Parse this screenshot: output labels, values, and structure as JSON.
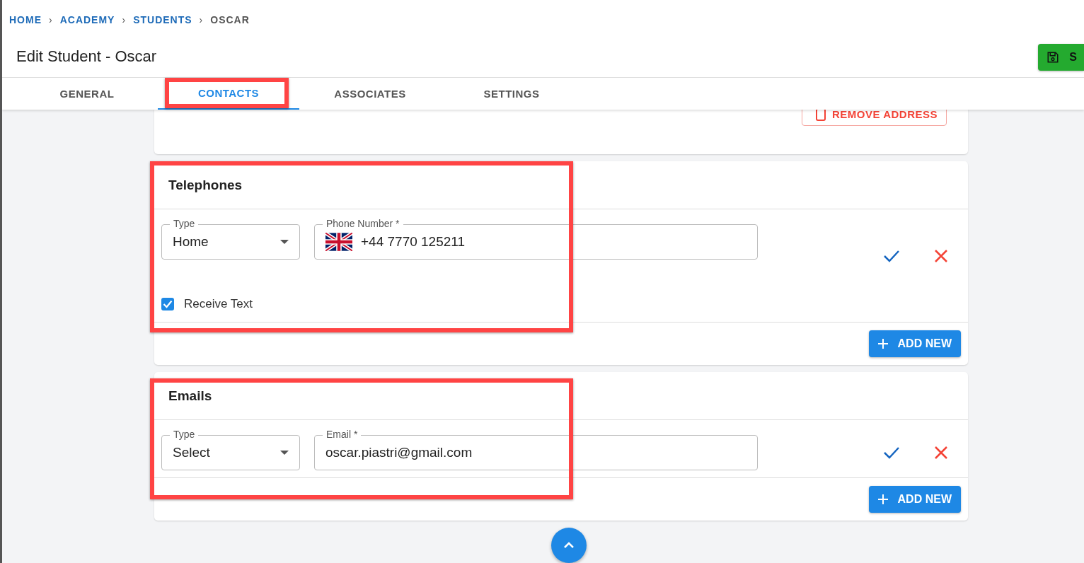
{
  "breadcrumb": [
    {
      "label": "HOME",
      "current": false
    },
    {
      "label": "ACADEMY",
      "current": false
    },
    {
      "label": "STUDENTS",
      "current": false
    },
    {
      "label": "OSCAR",
      "current": true
    }
  ],
  "breadcrumb_separator": "›",
  "title": "Edit Student - Oscar",
  "save_button": {
    "label": "S"
  },
  "tabs": [
    {
      "label": "GENERAL",
      "selected": false,
      "highlighted": false
    },
    {
      "label": "CONTACTS",
      "selected": true,
      "highlighted": true
    },
    {
      "label": "ASSOCIATES",
      "selected": false,
      "highlighted": false
    },
    {
      "label": "SETTINGS",
      "selected": false,
      "highlighted": false
    }
  ],
  "address_card": {
    "remove_button": "REMOVE ADDRESS"
  },
  "telephones": {
    "title": "Telephones",
    "highlighted": true,
    "type_label": "Type",
    "type_value": "Home",
    "number_label": "Phone Number *",
    "number_value": "+44 7770 125211",
    "receive_text": {
      "label": "Receive Text",
      "checked": true
    },
    "add_button": "ADD NEW"
  },
  "emails": {
    "title": "Emails",
    "highlighted": true,
    "type_label": "Type",
    "type_value": "Select",
    "email_label": "Email *",
    "email_value": "oscar.piastri@gmail.com",
    "add_button": "ADD NEW"
  }
}
